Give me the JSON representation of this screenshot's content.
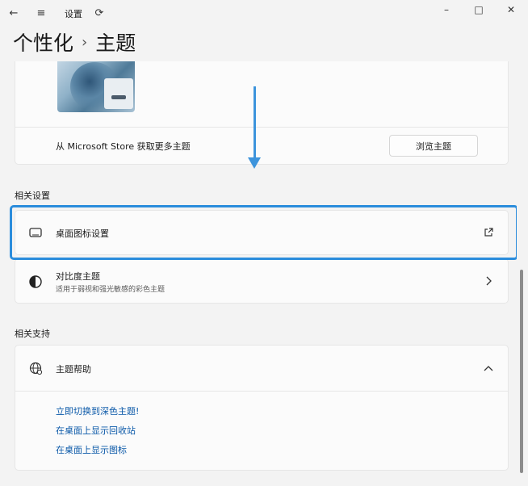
{
  "window": {
    "app_title": "设置",
    "minimize": "–",
    "maximize": "□",
    "close": "✕"
  },
  "icons": {
    "back": "back-arrow-icon",
    "menu": "hamburger-menu-icon",
    "refresh": "refresh-icon",
    "desktop": "monitor-icon",
    "contrast": "contrast-icon",
    "globe": "globe-help-icon",
    "external": "external-link-icon",
    "chevron_right": "chevron-right-icon",
    "chevron_up": "chevron-up-icon"
  },
  "breadcrumb": {
    "parent": "个性化",
    "separator": "›",
    "current": "主题"
  },
  "theme_section": {
    "store_text": "从 Microsoft Store 获取更多主题",
    "browse_button": "浏览主题"
  },
  "related_settings": {
    "label": "相关设置",
    "items": [
      {
        "title": "桌面图标设置"
      },
      {
        "title": "对比度主题",
        "subtitle": "适用于弱视和强光敏感的彩色主题"
      }
    ]
  },
  "related_support": {
    "label": "相关支持",
    "help_title": "主题帮助",
    "links": [
      "立即切换到深色主题!",
      "在桌面上显示回收站",
      "在桌面上显示图标"
    ]
  },
  "colors": {
    "accent": "#2a8cdc",
    "link": "#0a58a8",
    "background": "#f3f3f3"
  }
}
